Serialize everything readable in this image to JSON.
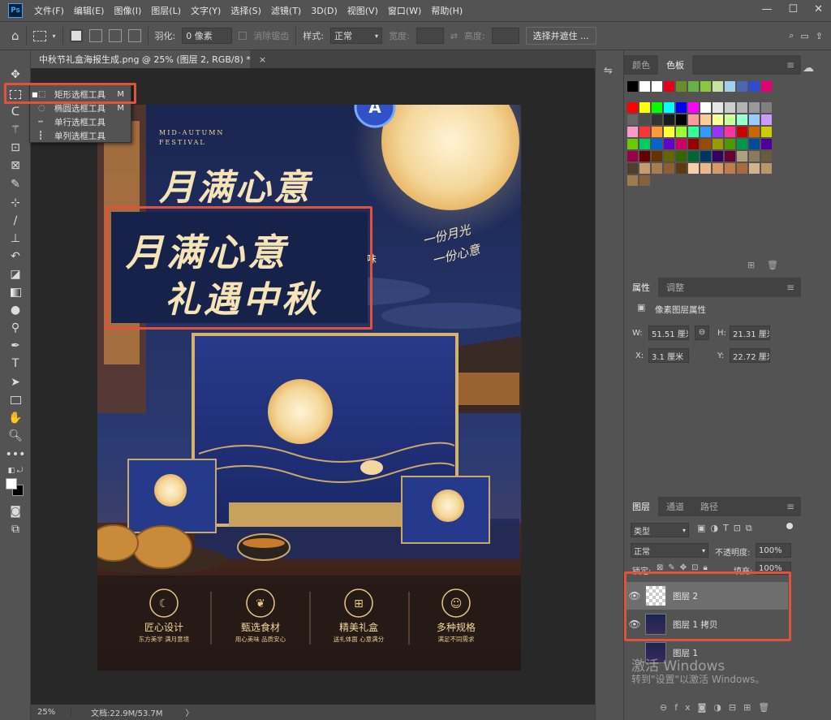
{
  "app": {
    "icon_label": "Ps"
  },
  "menubar": {
    "items": [
      "文件(F)",
      "编辑(E)",
      "图像(I)",
      "图层(L)",
      "文字(Y)",
      "选择(S)",
      "滤镜(T)",
      "3D(D)",
      "视图(V)",
      "窗口(W)",
      "帮助(H)"
    ],
    "window_controls": [
      "—",
      "☐",
      "✕"
    ]
  },
  "options": {
    "feather_label": "羽化:",
    "feather_value": "0 像素",
    "antialias_label": "消除锯齿",
    "style_label": "样式:",
    "style_value": "正常",
    "width_label": "宽度:",
    "height_label": "高度:",
    "select_mask_button": "选择并遮住 ..."
  },
  "flyout": {
    "items": [
      {
        "label": "矩形选框工具",
        "key": "M",
        "selected": true
      },
      {
        "label": "椭圆选框工具",
        "key": "M",
        "selected": false
      },
      {
        "label": "单行选框工具",
        "key": "",
        "selected": false
      },
      {
        "label": "单列选框工具",
        "key": "",
        "selected": false
      }
    ]
  },
  "document": {
    "tab_title": "中秋节礼盒海报生成.png @ 25% (图层 2, RGB/8) *",
    "close": "×"
  },
  "poster": {
    "mid_autumn_en_1": "MID-AUTUMN",
    "mid_autumn_en_2": "FESTIVAL",
    "headline_1": "月满心意",
    "headline_2": "礼遇中秋",
    "headline_partial_char": "味",
    "side_note_1": "一份月光",
    "side_note_2": "一份心意",
    "features": [
      {
        "title": "匠心设计",
        "subtitle": "东方美学  满月意境",
        "icon": "moon-icon"
      },
      {
        "title": "甄选食材",
        "subtitle": "用心美味  品质安心",
        "icon": "leaf-icon"
      },
      {
        "title": "精美礼盒",
        "subtitle": "送礼体面  心意满分",
        "icon": "gift-icon"
      },
      {
        "title": "多种规格",
        "subtitle": "满足不同需求",
        "icon": "people-icon"
      }
    ]
  },
  "overlay": {
    "headline_1": "月满心意",
    "headline_2": "礼遇中秋"
  },
  "status": {
    "zoom": "25%",
    "doc_size": "文档:22.9M/53.7M",
    "arrow": "〉"
  },
  "color_panel": {
    "tabs": [
      "颜色",
      "色板"
    ],
    "active_tab": "色板",
    "top_row": [
      "#000000",
      "#ffffff",
      "#ffffff",
      "#e3001b",
      "#6b8c2a",
      "#68b245",
      "#8cc63f",
      "#c7e3a1",
      "#9fd1ee",
      "#4a67b0",
      "#2e4bd6",
      "#e30074"
    ],
    "grid_colors": [
      "#ff0000",
      "#ffff00",
      "#00ff00",
      "#00ffff",
      "#0000ff",
      "#ff00ff",
      "#ffffff",
      "#e6e6e6",
      "#cccccc",
      "#b3b3b3",
      "#999999",
      "#808080",
      "#666666",
      "#4d4d4d",
      "#333333",
      "#1a1a1a",
      "#000000",
      "#ff9999",
      "#ffcc99",
      "#ffff99",
      "#ccff99",
      "#99ffcc",
      "#99ccff",
      "#cc99ff",
      "#ff99cc",
      "#ff3333",
      "#ff9933",
      "#ffff33",
      "#99ff33",
      "#33ff99",
      "#3399ff",
      "#9933ff",
      "#ff3399",
      "#cc0000",
      "#cc6600",
      "#cccc00",
      "#66cc00",
      "#00cc66",
      "#0066cc",
      "#6600cc",
      "#cc0066",
      "#990000",
      "#994c00",
      "#999900",
      "#4c9900",
      "#00994c",
      "#004c99",
      "#4c0099",
      "#99004c",
      "#660000",
      "#663300",
      "#666600",
      "#336600",
      "#006633",
      "#003366",
      "#330066",
      "#660033",
      "#b0a080",
      "#8c7a5c",
      "#6b5a3e",
      "#4d3f29",
      "#c69c6d",
      "#a67c52",
      "#8b5e34",
      "#603913",
      "#f5d0a9",
      "#e8b88a",
      "#d59a6a",
      "#c27c4b",
      "#a86a3f",
      "#d1b48c",
      "#b8976b",
      "#9e7b4f",
      "#85623a"
    ],
    "grid_note": "palette"
  },
  "properties_panel": {
    "tabs": [
      "属性",
      "调整"
    ],
    "active_tab": "属性",
    "type_label": "像素图层属性",
    "w_label": "W:",
    "w_value": "51.51 厘米",
    "h_label": "H:",
    "h_value": "21.31 厘米",
    "x_label": "X:",
    "x_value": "3.1 厘米",
    "y_label": "Y:",
    "y_value": "22.72 厘米"
  },
  "layers_panel": {
    "tabs": [
      "图层",
      "通道",
      "路径"
    ],
    "active_tab": "图层",
    "filter_value": "类型",
    "blend_mode": "正常",
    "opacity_label": "不透明度:",
    "opacity_value": "100%",
    "lock_label": "锁定:",
    "fill_label": "填充:",
    "fill_value": "100%",
    "layers": [
      {
        "name": "图层 2",
        "selected": true
      },
      {
        "name": "图层 1 拷贝",
        "selected": false
      },
      {
        "name": "图层 1",
        "selected": false
      }
    ]
  },
  "watermark": {
    "line1": "激活 Windows",
    "line2": "转到\"设置\"以激活 Windows。"
  },
  "colors": {
    "accent_red": "#e2523a",
    "poster_gold": "#f3d79b",
    "poster_navy": "#1f2b5c"
  }
}
